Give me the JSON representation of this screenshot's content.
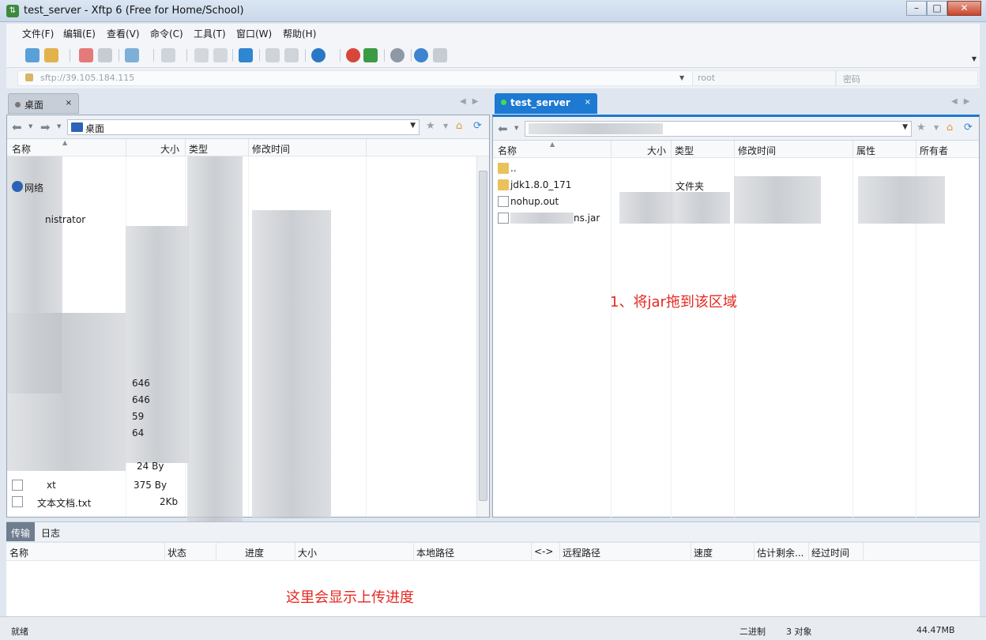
{
  "window": {
    "title": "test_server - Xftp 6 (Free for Home/School)"
  },
  "menu": [
    "文件(F)",
    "编辑(E)",
    "查看(V)",
    "命令(C)",
    "工具(T)",
    "窗口(W)",
    "帮助(H)"
  ],
  "address": {
    "host": "sftp://39.105.184.115",
    "user_placeholder": "root",
    "password_placeholder": "密码"
  },
  "left_tab": {
    "label": "桌面",
    "close": "×"
  },
  "right_tab": {
    "label": "test_server",
    "close": "×"
  },
  "left_pane": {
    "path": "桌面",
    "columns": [
      "名称",
      "大小",
      "类型",
      "修改时间"
    ],
    "visible_fragments": {
      "network": "网络",
      "admin": "nistrator",
      "sizes": [
        "646",
        "646",
        "59",
        "64",
        "24 By",
        "375 By",
        "2Kb"
      ],
      "txt1": "xt",
      "txt2": "文本文档.txt"
    }
  },
  "right_pane": {
    "columns": [
      "名称",
      "大小",
      "类型",
      "修改时间",
      "属性",
      "所有者"
    ],
    "rows": [
      {
        "name": "..",
        "type": "",
        "icon": "folder"
      },
      {
        "name": "jdk1.8.0_171",
        "type": "文件夹",
        "icon": "folder"
      },
      {
        "name": "nohup.out",
        "type": "",
        "icon": "file"
      },
      {
        "name": "ns.jar",
        "type": "",
        "icon": "jar-file"
      }
    ],
    "annotation": "1、将jar拖到该区域"
  },
  "transfer": {
    "tabs": [
      "传输",
      "日志"
    ],
    "columns": [
      "名称",
      "状态",
      "进度",
      "大小",
      "本地路径",
      "<->",
      "远程路径",
      "速度",
      "估计剩余...",
      "经过时间"
    ],
    "annotation": "这里会显示上传进度"
  },
  "status": {
    "left": "就绪",
    "mode": "二进制",
    "count": "3 对象",
    "size": "44.47MB"
  },
  "colors": {
    "accent": "#1d79d1",
    "annotation": "#e6261f"
  }
}
